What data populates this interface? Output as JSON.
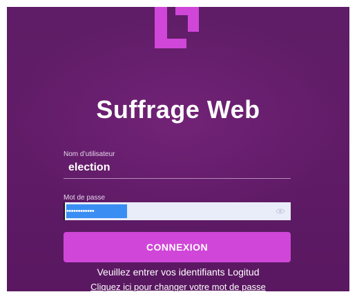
{
  "app": {
    "title": "Suffrage Web"
  },
  "form": {
    "username_label": "Nom d’utilisateur",
    "username_value": "election",
    "password_label": "Mot de passe",
    "password_masked": "••••••••••••",
    "submit_label": "CONNEXION"
  },
  "footer": {
    "hint": "Veuillez entrer vos identifiants Logitud",
    "change_password_link": "Cliquez ici pour changer votre mot de passe"
  },
  "icons": {
    "logo": "logitud-logo-icon",
    "show_password": "eye-icon"
  },
  "colors": {
    "background": "#5e1d66",
    "accent": "#d046d8",
    "input_background": "#e9edf9",
    "selection": "#3a8ef3"
  }
}
